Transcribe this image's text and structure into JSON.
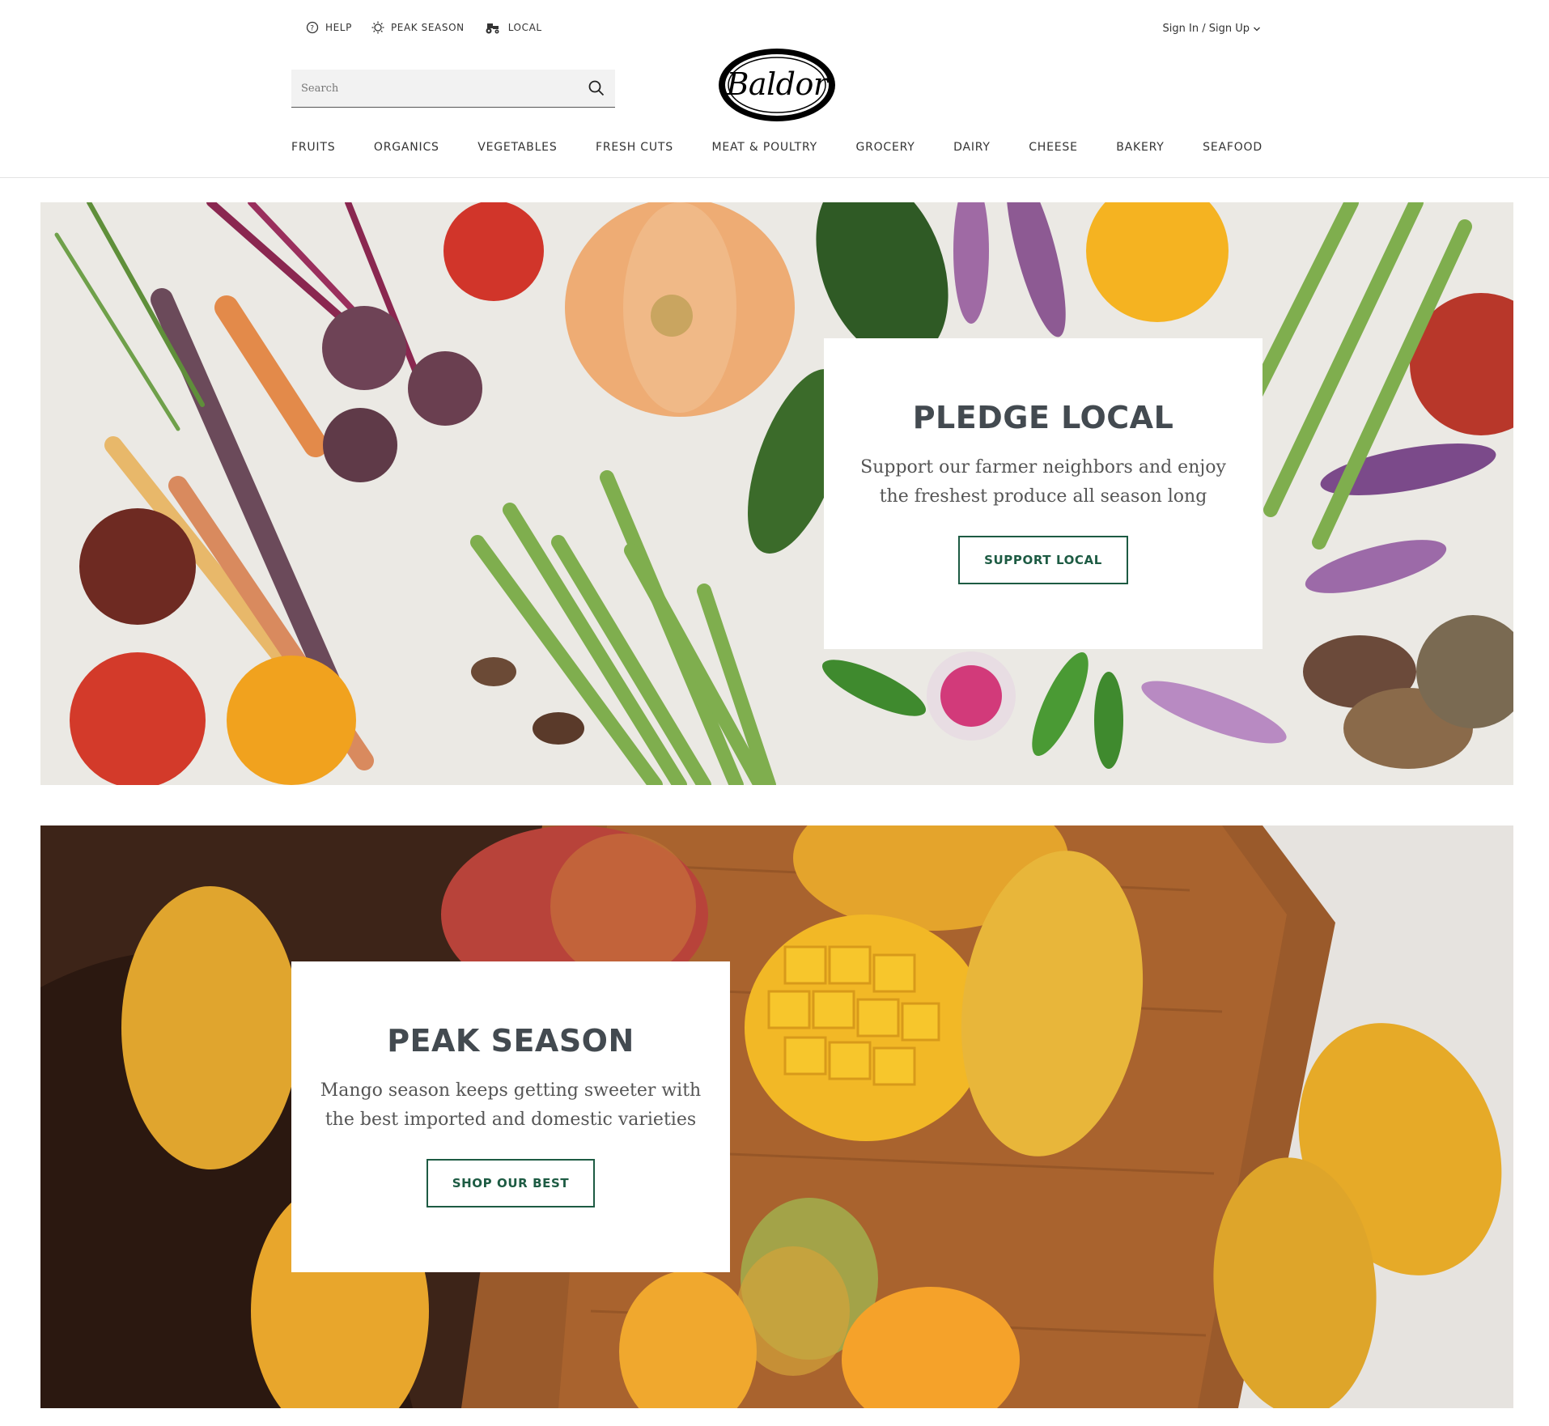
{
  "utility": {
    "help": "HELP",
    "peak_season": "PEAK SEASON",
    "local": "LOCAL"
  },
  "account": {
    "signin": "Sign In / Sign Up"
  },
  "search": {
    "placeholder": "Search"
  },
  "logo": {
    "text": "Baldor"
  },
  "nav": {
    "items": [
      "FRUITS",
      "ORGANICS",
      "VEGETABLES",
      "FRESH CUTS",
      "MEAT & POULTRY",
      "GROCERY",
      "DAIRY",
      "CHEESE",
      "BAKERY",
      "SEAFOOD"
    ]
  },
  "banners": [
    {
      "title": "PLEDGE LOCAL",
      "text": "Support our farmer neighbors and enjoy the freshest produce all season long",
      "button": "SUPPORT LOCAL"
    },
    {
      "title": "PEAK SEASON",
      "text": "Mango season keeps getting sweeter with the best imported and domestic varieties",
      "button": "SHOP OUR BEST"
    }
  ],
  "colors": {
    "accent": "#1d5b43",
    "heading": "#434a50"
  }
}
